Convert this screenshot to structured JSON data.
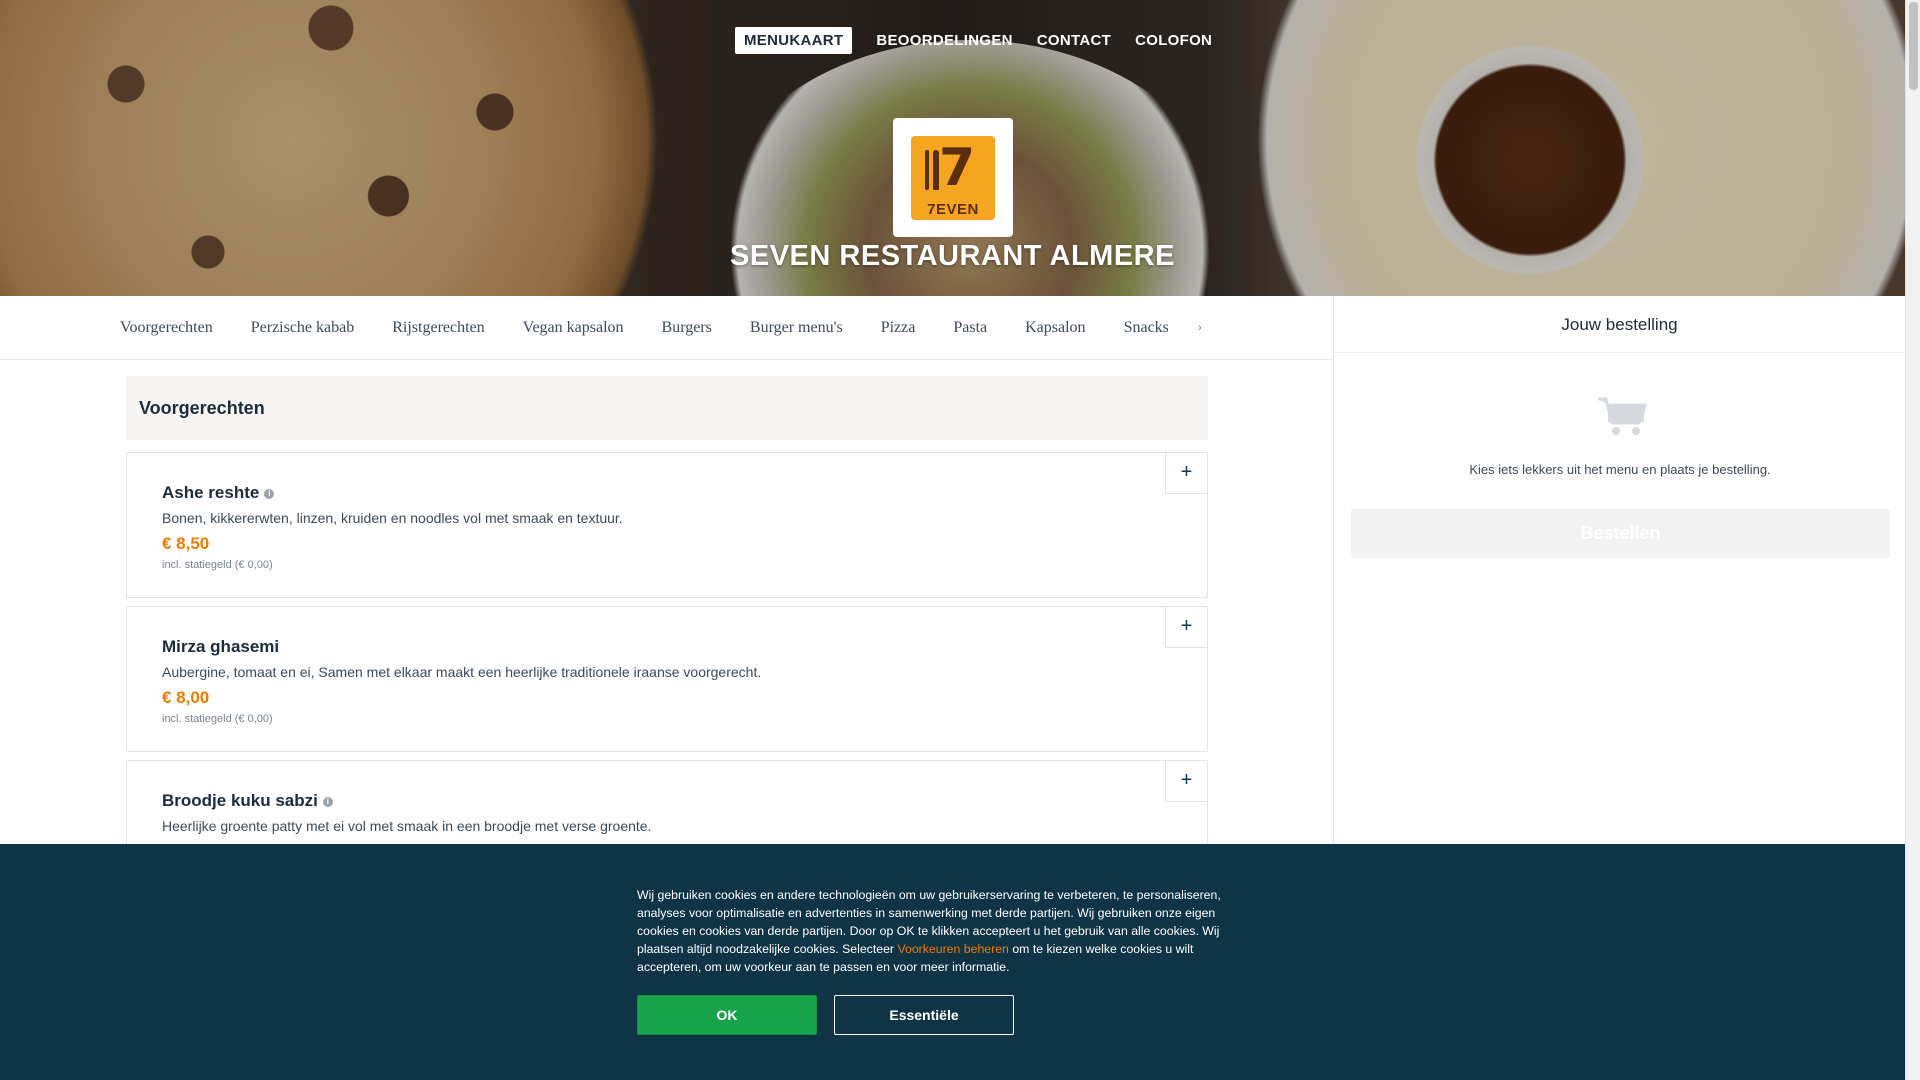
{
  "topnav": {
    "items": [
      {
        "label": "MENUKAART",
        "active": true
      },
      {
        "label": "BEOORDELINGEN",
        "active": false
      },
      {
        "label": "CONTACT",
        "active": false
      },
      {
        "label": "COLOFON",
        "active": false
      }
    ]
  },
  "logo": {
    "numeral": "7",
    "wordmark": "7EVEN"
  },
  "restaurant": {
    "title": "SEVEN RESTAURANT ALMERE"
  },
  "categories": {
    "items": [
      "Voorgerechten",
      "Perzische kabab",
      "Rijstgerechten",
      "Vegan kapsalon",
      "Burgers",
      "Burger menu's",
      "Pizza",
      "Pasta",
      "Kapsalon",
      "Snacks"
    ],
    "more_icon": "chevron-right-icon"
  },
  "section": {
    "title": "Voorgerechten"
  },
  "products": [
    {
      "name": "Ashe reshte",
      "has_info": true,
      "description": "Bonen, kikkererwten, linzen, kruiden en noodles vol met smaak en textuur.",
      "price": "€ 8,50",
      "deposit": "incl. statiegeld (€ 0,00)",
      "add": "+"
    },
    {
      "name": "Mirza ghasemi",
      "has_info": false,
      "description": "Aubergine, tomaat en ei, Samen met elkaar maakt een heerlijke traditionele iraanse voorgerecht.",
      "price": "€ 8,00",
      "deposit": "incl. statiegeld (€ 0,00)",
      "add": "+"
    },
    {
      "name": "Broodje kuku sabzi",
      "has_info": true,
      "description": "Heerlijke groente patty met ei vol met smaak in een broodje met verse groente.",
      "price": "",
      "deposit": "",
      "add": "+"
    }
  ],
  "basket": {
    "title": "Jouw bestelling",
    "cart_icon": "shopping-cart-icon",
    "empty_text": "Kies iets lekkers uit het menu en plaats je bestelling.",
    "order_button": "Bestellen"
  },
  "cookie": {
    "text_before": "Wij gebruiken cookies en andere technologieën om uw gebruikerservaring te verbeteren, te personaliseren, analyses voor optimalisatie en advertenties in samenwerking met derde partijen. Wij gebruiken onze eigen cookies en cookies van derde partijen. Door op OK te klikken accepteert u het gebruik van alle cookies. Wij plaatsen altijd noodzakelijke cookies. Selecteer ",
    "link": "Voorkeuren beheren",
    "text_after": " om te kiezen welke cookies u wilt accepteren, om uw voorkeur aan te passen en voor meer informatie.",
    "ok_button": "OK",
    "essential_button": "Essentiële"
  },
  "colors": {
    "accent_orange": "#f27a00",
    "navy": "#0f3445",
    "ok_green": "#16a34a",
    "text_dark": "#1d2b3a"
  }
}
